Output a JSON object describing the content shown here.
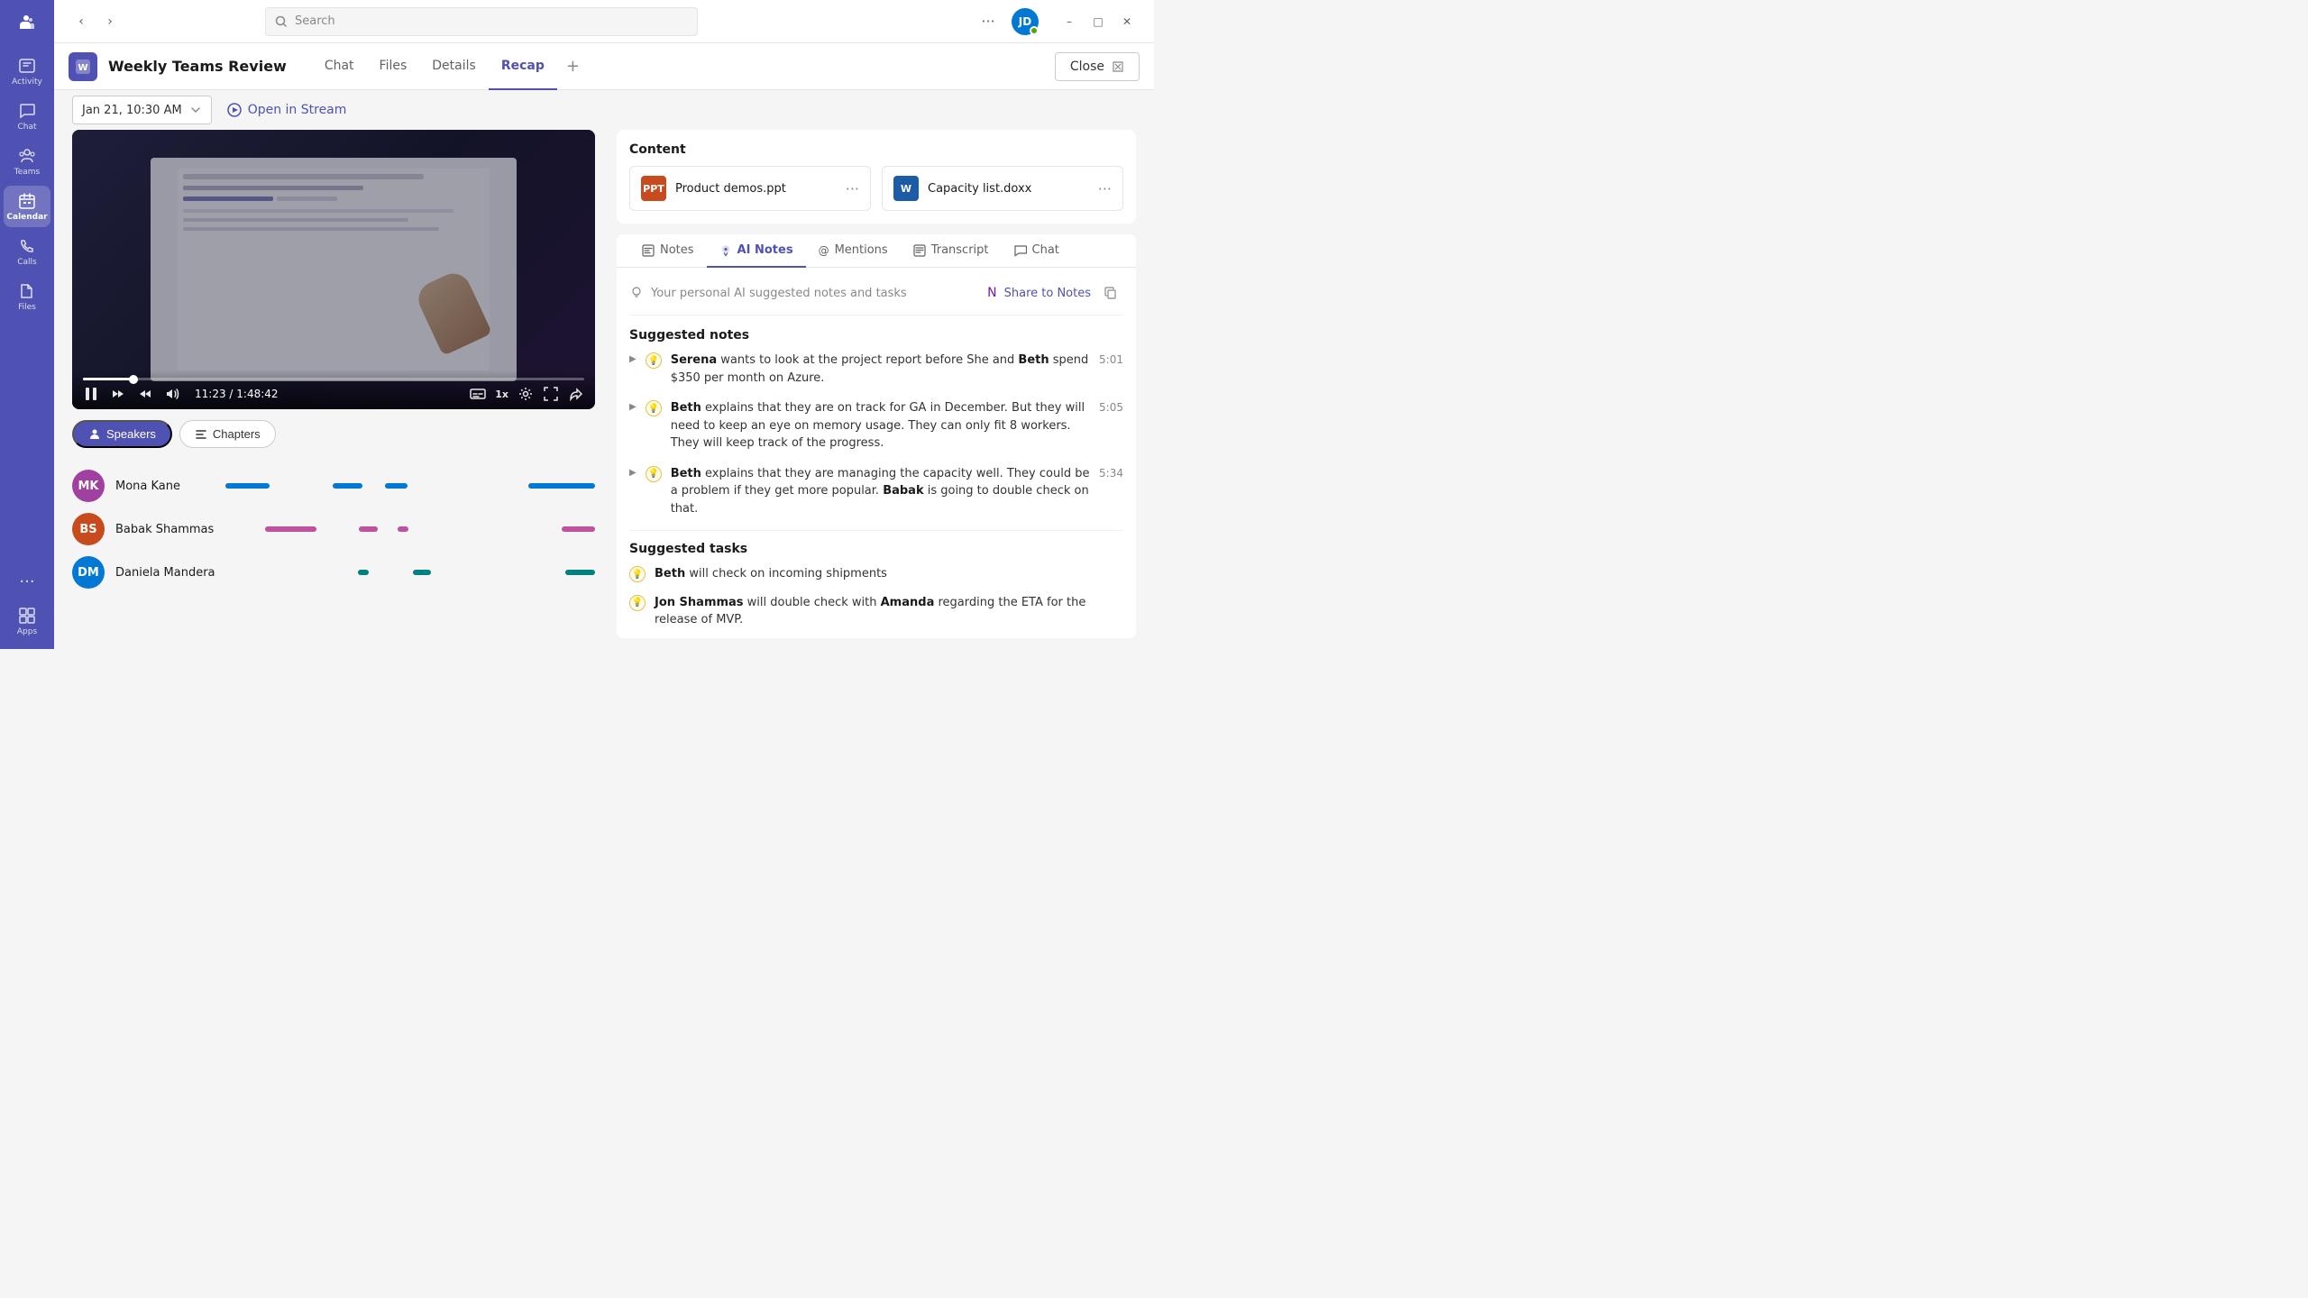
{
  "sidebar": {
    "logo_label": "Microsoft Teams",
    "items": [
      {
        "id": "activity",
        "label": "Activity",
        "active": false
      },
      {
        "id": "chat",
        "label": "Chat",
        "active": false
      },
      {
        "id": "teams",
        "label": "Teams",
        "active": false
      },
      {
        "id": "calendar",
        "label": "Calendar",
        "active": true
      },
      {
        "id": "calls",
        "label": "Calls",
        "active": false
      },
      {
        "id": "files",
        "label": "Files",
        "active": false
      }
    ],
    "bottom_items": [
      {
        "id": "apps",
        "label": "Apps",
        "active": false
      }
    ]
  },
  "topbar": {
    "search_placeholder": "Search",
    "more_options_label": "More options"
  },
  "channel": {
    "title": "Weekly Teams Review",
    "icon_letter": "W",
    "tabs": [
      {
        "id": "chat",
        "label": "Chat",
        "active": false
      },
      {
        "id": "files",
        "label": "Files",
        "active": false
      },
      {
        "id": "details",
        "label": "Details",
        "active": false
      },
      {
        "id": "recap",
        "label": "Recap",
        "active": true
      }
    ],
    "close_label": "Close",
    "add_tab_label": "+"
  },
  "recap_toolbar": {
    "date_label": "Jan 21, 10:30 AM",
    "open_stream_label": "Open in Stream"
  },
  "video": {
    "current_time": "11:23",
    "total_time": "1:48:42",
    "progress_pct": 10
  },
  "speakers_tabs": [
    {
      "id": "speakers",
      "label": "Speakers",
      "active": true,
      "icon": "👤"
    },
    {
      "id": "chapters",
      "label": "Chapters",
      "active": false,
      "icon": "☰"
    }
  ],
  "speakers": [
    {
      "name": "Mona Kane",
      "initials": "MK",
      "color": "#a040a0",
      "segments": [
        {
          "color": "#0078d4",
          "width": "12%"
        },
        {
          "color": "#0078d4",
          "width": "8%"
        },
        {
          "color": "#0078d4",
          "width": "6%"
        },
        {
          "color": "#0078d4",
          "width": "18%"
        }
      ]
    },
    {
      "name": "Babak Shammas",
      "initials": "BS",
      "color": "#c84b1e",
      "segments": [
        {
          "color": "#c050a0",
          "width": "14%"
        },
        {
          "color": "#c050a0",
          "width": "5%"
        },
        {
          "color": "#c050a0",
          "width": "3%"
        },
        {
          "color": "#c050a0",
          "width": "9%"
        }
      ]
    },
    {
      "name": "Daniela Mandera",
      "initials": "DM",
      "color": "#0078d4",
      "segments": [
        {
          "color": "#008080",
          "width": "3%"
        },
        {
          "color": "#008080",
          "width": "5%"
        },
        {
          "color": "#008080",
          "width": "8%"
        }
      ]
    }
  ],
  "content_section": {
    "label": "Content",
    "files": [
      {
        "id": "ppt",
        "name": "Product demos.ppt",
        "type": "ppt",
        "type_label": "PPT"
      },
      {
        "id": "docx",
        "name": "Capacity list.doxx",
        "type": "docx",
        "type_label": "W"
      }
    ]
  },
  "ai_tabs": [
    {
      "id": "notes",
      "label": "Notes",
      "active": false,
      "icon": "📋"
    },
    {
      "id": "ai-notes",
      "label": "AI Notes",
      "active": true,
      "icon": "💡"
    },
    {
      "id": "mentions",
      "label": "Mentions",
      "active": false,
      "icon": "@"
    },
    {
      "id": "transcript",
      "label": "Transcript",
      "active": false,
      "icon": "📄"
    },
    {
      "id": "chat",
      "label": "Chat",
      "active": false,
      "icon": "💬"
    }
  ],
  "ai_header": {
    "description": "Your personal AI suggested notes and tasks",
    "share_label": "Share to Notes"
  },
  "suggested_notes": {
    "title": "Suggested notes",
    "items": [
      {
        "id": 1,
        "text_parts": [
          {
            "bold": true,
            "text": "Serena"
          },
          {
            "bold": false,
            "text": " wants to look at the project report before She and "
          },
          {
            "bold": true,
            "text": "Beth"
          },
          {
            "bold": false,
            "text": " spend $350 per month on Azure."
          }
        ],
        "timestamp": "5:01"
      },
      {
        "id": 2,
        "text_parts": [
          {
            "bold": true,
            "text": "Beth"
          },
          {
            "bold": false,
            "text": " explains that they are on track for GA in December. But they will need to keep an eye on memory usage. They can only fit 8 workers. They will keep track of the progress."
          }
        ],
        "timestamp": "5:05"
      },
      {
        "id": 3,
        "text_parts": [
          {
            "bold": true,
            "text": "Beth"
          },
          {
            "bold": false,
            "text": " explains that they are managing the capacity well. They could be a problem if they get more popular. "
          },
          {
            "bold": true,
            "text": "Babak"
          },
          {
            "bold": false,
            "text": " is going to double check on that."
          }
        ],
        "timestamp": "5:34"
      }
    ]
  },
  "suggested_tasks": {
    "title": "Suggested tasks",
    "items": [
      {
        "id": 1,
        "text_parts": [
          {
            "bold": true,
            "text": "Beth"
          },
          {
            "bold": false,
            "text": " will check on incoming shipments"
          }
        ]
      },
      {
        "id": 2,
        "text_parts": [
          {
            "bold": true,
            "text": "Jon Shammas"
          },
          {
            "bold": false,
            "text": " will double check with "
          },
          {
            "bold": true,
            "text": "Amanda"
          },
          {
            "bold": false,
            "text": " regarding the ETA for the release of MVP."
          }
        ]
      }
    ]
  }
}
